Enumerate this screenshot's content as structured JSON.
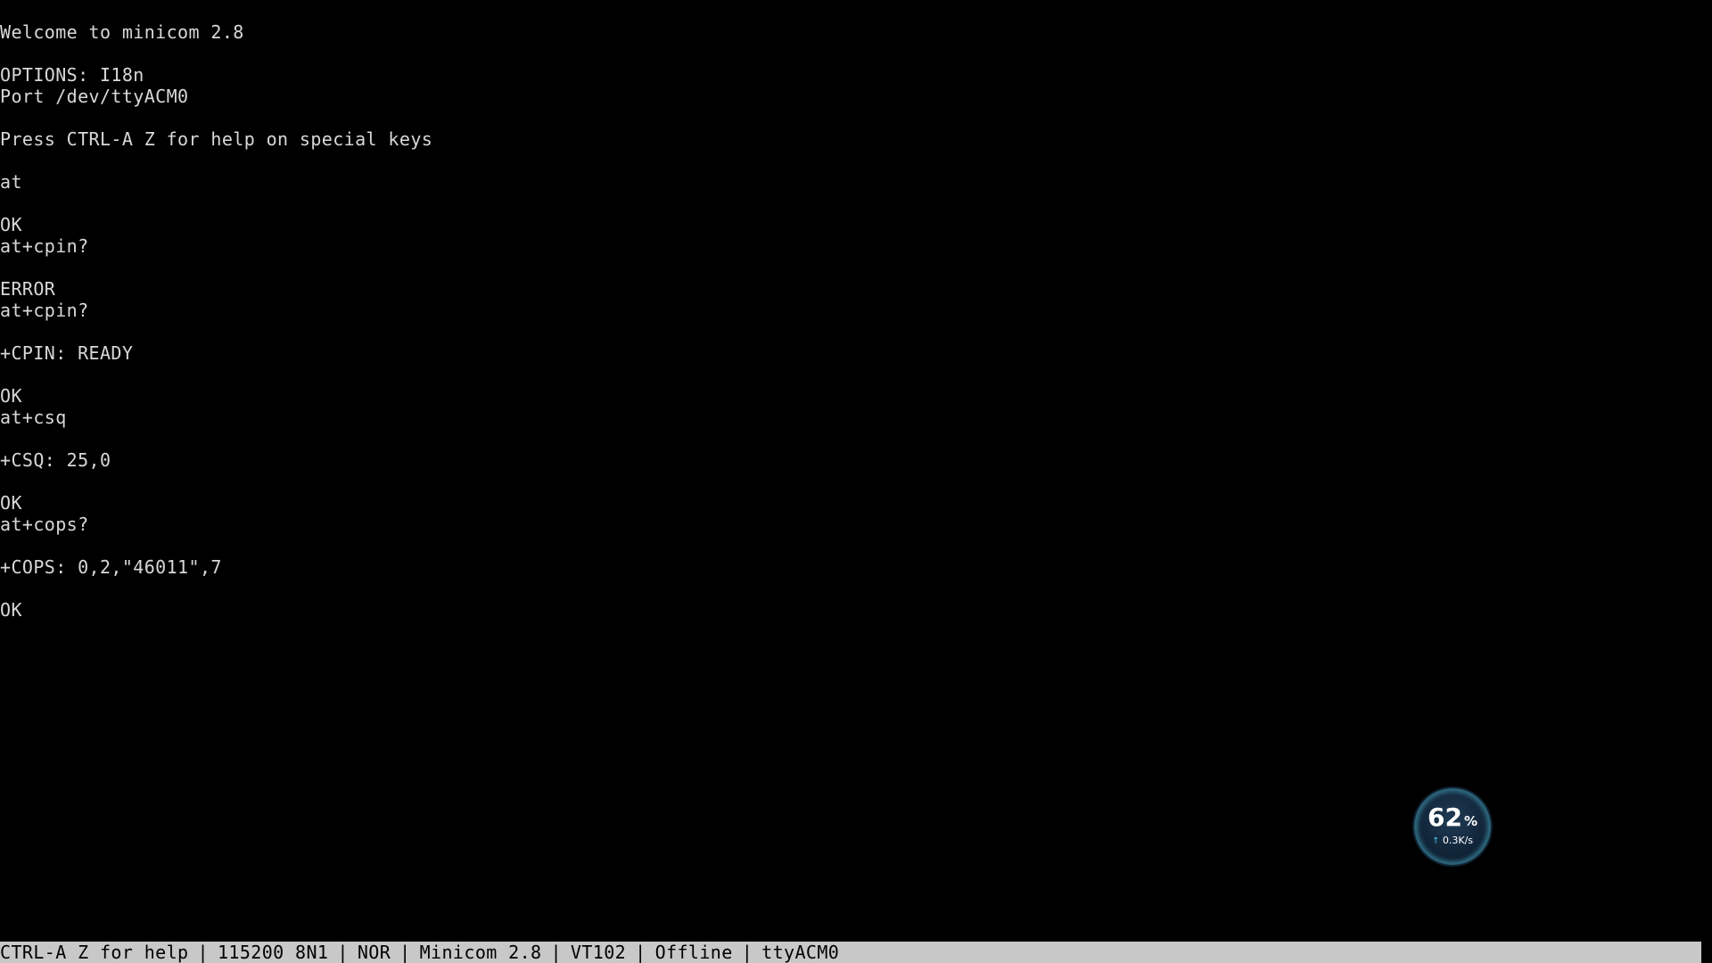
{
  "terminal": {
    "lines": [
      "Welcome to minicom 2.8",
      "",
      "OPTIONS: I18n",
      "Port /dev/ttyACM0",
      "",
      "Press CTRL-A Z for help on special keys",
      "",
      "at",
      "",
      "OK",
      "at+cpin?",
      "",
      "ERROR",
      "at+cpin?",
      "",
      "+CPIN: READY",
      "",
      "OK",
      "at+csq",
      "",
      "+CSQ: 25,0",
      "",
      "OK",
      "at+cops?",
      "",
      "+COPS: 0,2,\"46011\",7",
      "",
      "OK"
    ]
  },
  "statusbar": {
    "help": "CTRL-A Z for help",
    "speed": "115200 8N1",
    "mode": "NOR",
    "version": "Minicom 2.8",
    "emulation": "VT102",
    "state": "Offline",
    "device": "ttyACM0",
    "separator": "|"
  },
  "monitor_widget": {
    "percent": "62",
    "percent_unit": "%",
    "upload_arrow": "↑",
    "speed": "0.3K/s",
    "accent_color": "#3ec8e0"
  }
}
